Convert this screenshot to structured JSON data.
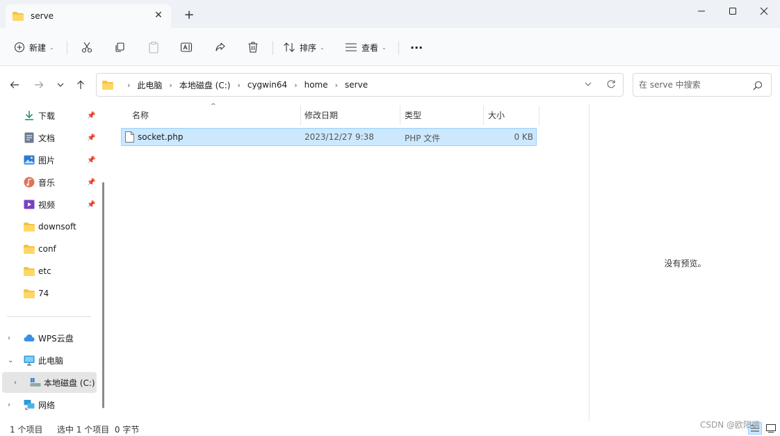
{
  "window": {
    "tab_title": "serve",
    "new_tab_symbol": "+",
    "close_tab_symbol": "✕"
  },
  "toolbar": {
    "new_label": "新建",
    "sort_label": "排序",
    "view_label": "查看",
    "more_label": "···"
  },
  "address": {
    "crumbs": [
      "此电脑",
      "本地磁盘 (C:)",
      "cygwin64",
      "home",
      "serve"
    ]
  },
  "search": {
    "placeholder": "在 serve 中搜索"
  },
  "sidebar": {
    "quick_access": [
      {
        "label": "下载",
        "icon": "download-icon",
        "pinned": true
      },
      {
        "label": "文档",
        "icon": "document-icon",
        "pinned": true
      },
      {
        "label": "图片",
        "icon": "picture-icon",
        "pinned": true
      },
      {
        "label": "音乐",
        "icon": "music-icon",
        "pinned": true
      },
      {
        "label": "视频",
        "icon": "video-icon",
        "pinned": true
      },
      {
        "label": "downsoft",
        "icon": "folder-icon",
        "pinned": false
      },
      {
        "label": "conf",
        "icon": "folder-icon",
        "pinned": false
      },
      {
        "label": "etc",
        "icon": "folder-icon",
        "pinned": false
      },
      {
        "label": "74",
        "icon": "folder-icon",
        "pinned": false
      }
    ],
    "tree": [
      {
        "label": "WPS云盘",
        "icon": "cloud-icon",
        "expander": "›"
      },
      {
        "label": "此电脑",
        "icon": "computer-icon",
        "expander": "⌄"
      },
      {
        "label": "本地磁盘 (C:)",
        "icon": "drive-icon",
        "expander": "›"
      },
      {
        "label": "网络",
        "icon": "network-icon",
        "expander": "›"
      }
    ]
  },
  "columns": {
    "name": "名称",
    "modified": "修改日期",
    "type": "类型",
    "size": "大小"
  },
  "files": [
    {
      "name": "socket.php",
      "modified": "2023/12/27 9:38",
      "type": "PHP 文件",
      "size": "0 KB"
    }
  ],
  "preview": {
    "message": "没有预览。"
  },
  "status": {
    "item_count": "1 个项目",
    "selection": "选中 1 个项目  0 字节"
  },
  "watermark": "CSDN @欧阳德"
}
